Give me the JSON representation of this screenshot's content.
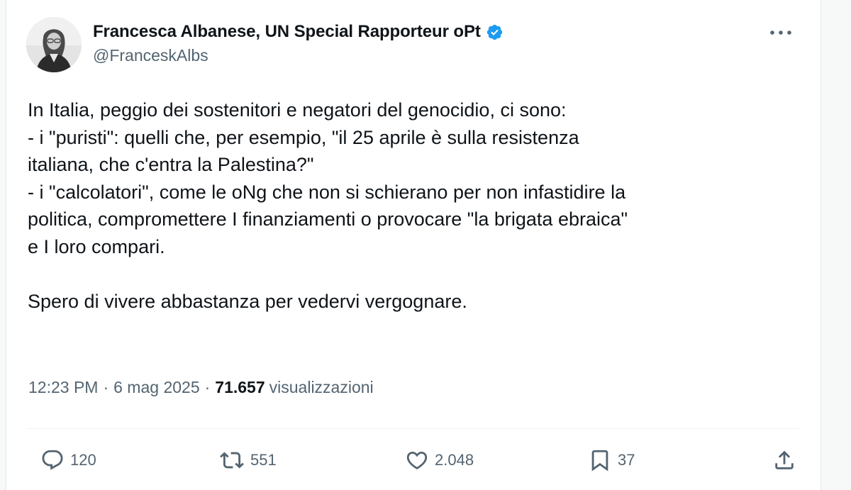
{
  "author": {
    "display_name": "Francesca Albanese, UN Special Rapporteur oPt",
    "handle": "@FranceskAlbs",
    "verified": true,
    "verified_color": "#1d9bf0"
  },
  "tweet": {
    "lines": [
      "In Italia, peggio dei sostenitori e negatori del genocidio, ci sono:",
      "- i \"puristi\": quelli che, per esempio, \"il 25 aprile è sulla resistenza",
      "italiana, che c'entra la Palestina?\"",
      "- i \"calcolatori\", come le oNg che non si schierano per non infastidire la",
      "politica, compromettere I finanziamenti o provocare \"la brigata ebraica\"",
      "e I loro compari.",
      "",
      "Spero di vivere abbastanza per vedervi vergognare."
    ]
  },
  "meta": {
    "time": "12:23 PM",
    "separator": "·",
    "date": "6 mag 2025",
    "views_count": "71.657",
    "views_label": "visualizzazioni"
  },
  "actions": {
    "reply": {
      "icon": "reply-icon",
      "count": "120"
    },
    "retweet": {
      "icon": "retweet-icon",
      "count": "551"
    },
    "like": {
      "icon": "heart-icon",
      "count": "2.048"
    },
    "bookmark": {
      "icon": "bookmark-icon",
      "count": "37"
    },
    "share": {
      "icon": "share-icon"
    }
  }
}
